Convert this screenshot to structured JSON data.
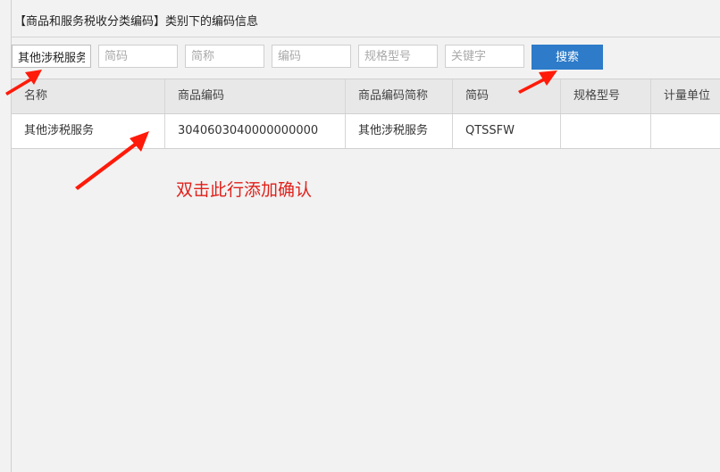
{
  "dialog": {
    "title": "【商品和服务税收分类编码】类别下的编码信息"
  },
  "filters": {
    "category_value": "其他涉税服务",
    "code_placeholder": "简码",
    "short_name_placeholder": "简称",
    "tax_code_placeholder": "编码",
    "spec_placeholder": "规格型号",
    "keyword_placeholder": "关键字",
    "search_label": "搜索"
  },
  "table": {
    "columns": [
      "名称",
      "商品编码",
      "商品编码简称",
      "简码",
      "规格型号",
      "计量单位"
    ],
    "rows": [
      [
        "其他涉税服务",
        "3040603040000000000",
        "其他涉税服务",
        "QTSSFW",
        "",
        ""
      ]
    ]
  },
  "annotation": {
    "text": "双击此行添加确认",
    "color": "#e0201a"
  },
  "colors": {
    "accent": "#2d7bc9",
    "annotation": "#e0201a"
  }
}
